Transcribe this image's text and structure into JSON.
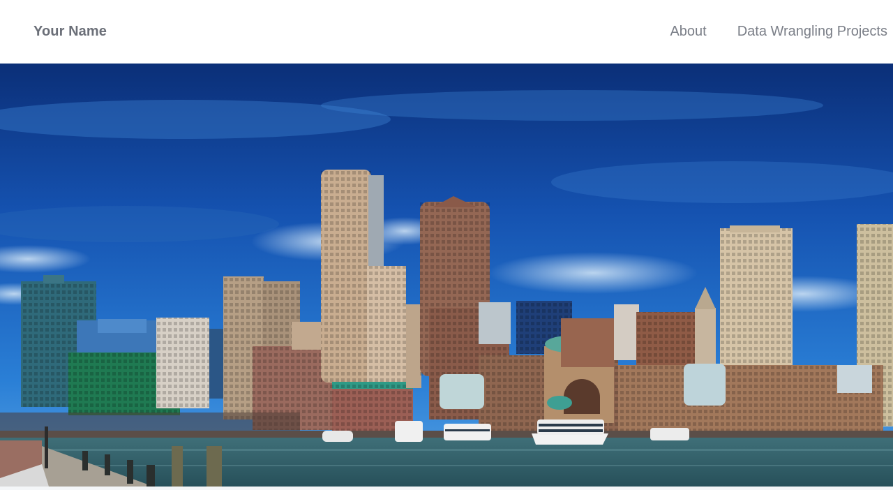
{
  "navbar": {
    "brand": "Your Name",
    "links": [
      {
        "label": "About"
      },
      {
        "label": "Data Wrangling Projects"
      }
    ]
  },
  "hero": {
    "image": "city-skyline-waterfront-photo"
  },
  "colors": {
    "brand_text": "#6b6f78",
    "nav_link_text": "#7a7e87",
    "sky_top": "#0c3a8c",
    "sky_mid": "#1b66c4",
    "water": "#2f5f6a"
  }
}
